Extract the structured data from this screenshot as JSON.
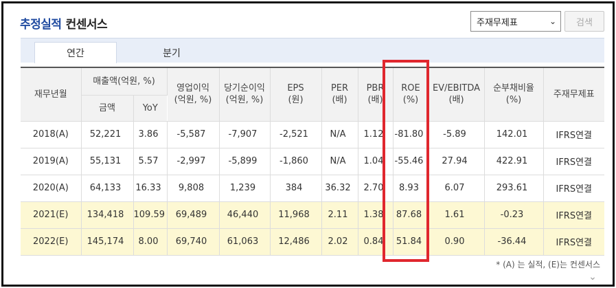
{
  "header": {
    "title_main": "추정실적",
    "title_sub": "컨센서스"
  },
  "controls": {
    "select_value": "주재무제표",
    "search_label": "검색",
    "chevron_icon": "chevron-down-icon"
  },
  "tabs": [
    {
      "label": "연간",
      "active": true
    },
    {
      "label": "분기",
      "active": false
    }
  ],
  "table": {
    "headers": {
      "period": "재무년월",
      "sales_group": "매출액(억원, %)",
      "sales_amount": "금액",
      "sales_yoy": "YoY",
      "op_income": [
        "영업이익",
        "(억원, %)"
      ],
      "net_income": [
        "당기순이익",
        "(억원, %)"
      ],
      "eps": [
        "EPS",
        "(원)"
      ],
      "per": [
        "PER",
        "(배)"
      ],
      "pbr": [
        "PBR",
        "(배)"
      ],
      "roe": [
        "ROE",
        "(%)"
      ],
      "ev_ebitda": [
        "EV/EBITDA",
        "(배)"
      ],
      "net_debt": [
        "순부채비율",
        "(%)"
      ],
      "fs_type": "주재무제표"
    },
    "rows": [
      {
        "period": "2018(A)",
        "sales": "52,221",
        "yoy": "3.86",
        "op": "-5,587",
        "net": "-7,907",
        "eps": "-2,521",
        "per": "N/A",
        "pbr": "1.12",
        "roe": "-81.80",
        "ev": "-5.89",
        "debt": "142.01",
        "fs": "IFRS연결"
      },
      {
        "period": "2019(A)",
        "sales": "55,131",
        "yoy": "5.57",
        "op": "-2,997",
        "net": "-5,899",
        "eps": "-1,860",
        "per": "N/A",
        "pbr": "1.04",
        "roe": "-55.46",
        "ev": "27.94",
        "debt": "422.91",
        "fs": "IFRS연결"
      },
      {
        "period": "2020(A)",
        "sales": "64,133",
        "yoy": "16.33",
        "op": "9,808",
        "net": "1,239",
        "eps": "384",
        "per": "36.32",
        "pbr": "2.70",
        "roe": "8.93",
        "ev": "6.07",
        "debt": "293.61",
        "fs": "IFRS연결"
      },
      {
        "period": "2021(E)",
        "sales": "134,418",
        "yoy": "109.59",
        "op": "69,489",
        "net": "46,440",
        "eps": "11,968",
        "per": "2.11",
        "pbr": "1.38",
        "roe": "87.68",
        "ev": "1.61",
        "debt": "-0.23",
        "fs": "IFRS연결"
      },
      {
        "period": "2022(E)",
        "sales": "145,174",
        "yoy": "8.00",
        "op": "69,740",
        "net": "61,063",
        "eps": "12,486",
        "per": "2.02",
        "pbr": "0.84",
        "roe": "51.84",
        "ev": "0.90",
        "debt": "-36.44",
        "fs": "IFRS연결"
      }
    ]
  },
  "footnote": "* (A) 는 실적, (E)는 컨센서스",
  "colors": {
    "title_blue": "#1f4aa0",
    "highlight_red": "#e0272e",
    "estimate_row_bg": "#fdf8d3",
    "negative_red": "#d32020"
  }
}
